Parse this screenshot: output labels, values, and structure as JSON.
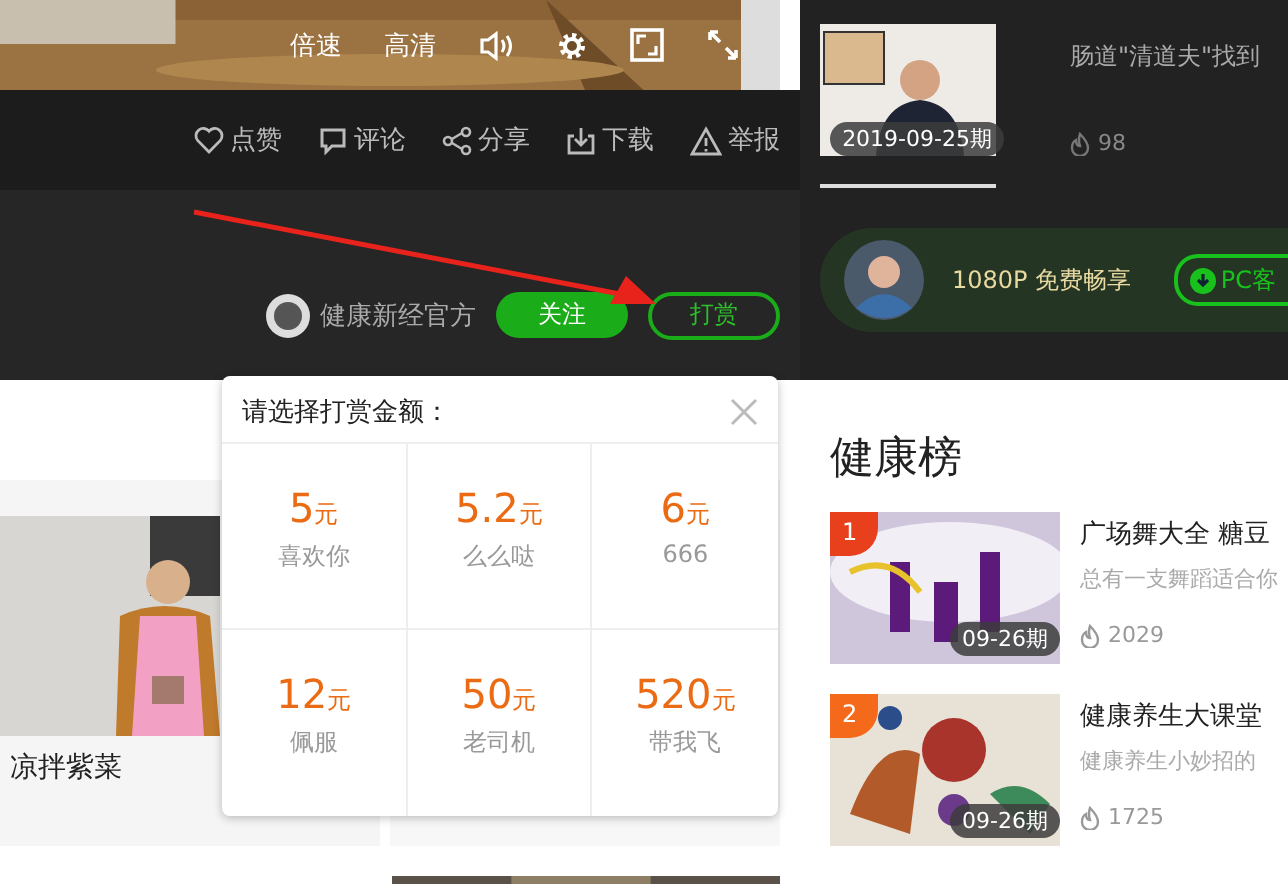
{
  "player_controls": {
    "speed": "倍速",
    "quality": "高清"
  },
  "actions": [
    {
      "kind": "like",
      "label": "点赞"
    },
    {
      "kind": "comment",
      "label": "评论"
    },
    {
      "kind": "share",
      "label": "分享"
    },
    {
      "kind": "download",
      "label": "下载"
    },
    {
      "kind": "report",
      "label": "举报"
    }
  ],
  "uploader": {
    "name": "健康新经官方",
    "follow": "关注",
    "reward": "打赏"
  },
  "reward_popup": {
    "title": "请选择打赏金额：",
    "options": [
      {
        "amount": "5",
        "unit": "元",
        "label": "喜欢你"
      },
      {
        "amount": "5.2",
        "unit": "元",
        "label": "么么哒"
      },
      {
        "amount": "6",
        "unit": "元",
        "label": "666"
      },
      {
        "amount": "12",
        "unit": "元",
        "label": "佩服"
      },
      {
        "amount": "50",
        "unit": "元",
        "label": "老司机"
      },
      {
        "amount": "520",
        "unit": "元",
        "label": "带我飞"
      }
    ]
  },
  "left_card": {
    "caption": "凉拌紫菜"
  },
  "related_video": {
    "date": "2019-09-25期",
    "title": "肠道\"清道夫\"找到",
    "views": "98"
  },
  "banner": {
    "text": "1080P 免费畅享",
    "button": "PC客"
  },
  "ranking": {
    "title": "健康榜",
    "items": [
      {
        "rank": "1",
        "date": "09-26期",
        "title": "广场舞大全 糖豆",
        "desc": "总有一支舞蹈适合你",
        "views": "2029",
        "color": "#e8401c"
      },
      {
        "rank": "2",
        "date": "09-26期",
        "title": "健康养生大课堂",
        "desc": "健康养生小妙招的",
        "views": "1725",
        "color": "#f56a1a"
      }
    ]
  }
}
